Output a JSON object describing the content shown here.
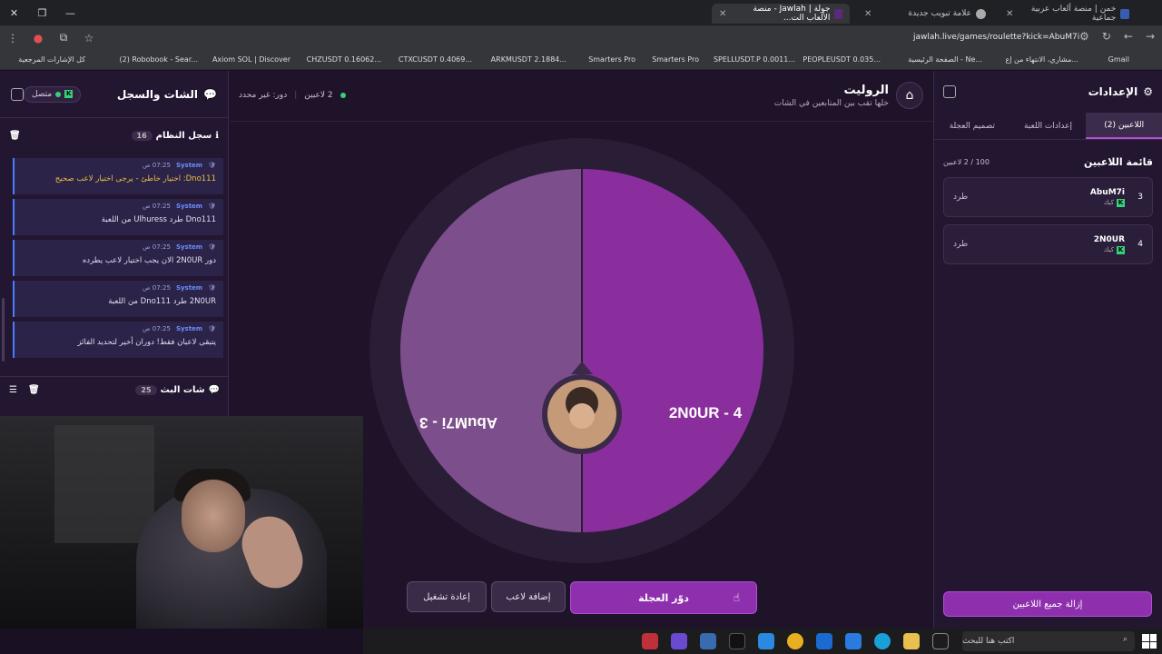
{
  "browser": {
    "tabs": [
      {
        "title": "خمن | منصة ألعاب عربية جماعية"
      },
      {
        "title": "علامة تبويب جديدة"
      },
      {
        "title": "جولة | Jawlah - منصة الألعاب الت..."
      }
    ],
    "url": "jawlah.live/games/roulette?kick=AbuM7i",
    "bookmarks": [
      "Gmail",
      "مشاري، الانتهاء من إع...",
      "الصفحة الرئيسية - Ne...",
      "PEOPLEUSDT 0.035...",
      "SPELLUSDT.P 0.0011...",
      "Smarters Pro",
      "Smarters Pro",
      "ARKMUSDT 2.1884...",
      "CTXCUSDT 0.4069...",
      "CHZUSDT 0.16062...",
      "Axiom SOL | Discover",
      "(2) Robobook - Sear...",
      "كل الإشارات المرجعية"
    ]
  },
  "chat": {
    "title": "الشات والسجل",
    "status": "متصل",
    "system_log": {
      "title": "سجل النظام",
      "count": "16"
    },
    "messages": [
      {
        "sender": "System",
        "time": "07:25 ص",
        "text": "Dno111: اختيار خاطئ - يرجى اختيار لاعب صحيح",
        "warn": true
      },
      {
        "sender": "System",
        "time": "07:25 ص",
        "text": "Dno111 طرد Ulhuress من اللعبة",
        "warn": false
      },
      {
        "sender": "System",
        "time": "07:25 ص",
        "text": "دور 2N0UR الان يجب اختيار لاعب يطرده",
        "warn": false
      },
      {
        "sender": "System",
        "time": "07:25 ص",
        "text": "2N0UR طرد Dno111 من اللعبة",
        "warn": false
      },
      {
        "sender": "System",
        "time": "07:25 ص",
        "text": "يتبقى لاعبان فقط! دوران أخير لتحديد الفائز",
        "warn": false
      }
    ],
    "stream_chat": {
      "title": "شات البث",
      "count": "25"
    }
  },
  "game": {
    "title": "الروليت",
    "subtitle": "خلها تقب بين المتابعين في الشات",
    "players_count": "2 لاعبين",
    "turn": "دور: غير محدد",
    "wheel": {
      "left_label": "AbuM7i - 3",
      "right_label": "2N0UR - 4",
      "left_color": "#7d4e8c",
      "right_color": "#8a2e9e"
    },
    "buttons": {
      "spin": "دوّر العجلة",
      "add_player": "إضافة لاعب",
      "restart": "إعادة تشغيل"
    }
  },
  "settings": {
    "title": "الإعدادات",
    "tabs": [
      "اللاعبين (2)",
      "إعدادات اللعبة",
      "تصميم العجلة"
    ],
    "list_title": "قائمة اللاعبين",
    "list_count": "100 / 2 لاعبين",
    "players": [
      {
        "num": "3",
        "name": "AbuM7i",
        "platform": "كيك",
        "action": "طرد"
      },
      {
        "num": "4",
        "name": "2N0UR",
        "platform": "كيك",
        "action": "طرد"
      }
    ],
    "remove_all": "إزالة جميع اللاعبين"
  },
  "taskbar": {
    "search_placeholder": "اكتب هنا للبحث"
  },
  "colors": {
    "accent": "#8e2fae",
    "online": "#33d17a",
    "kick": "#33d17a"
  }
}
